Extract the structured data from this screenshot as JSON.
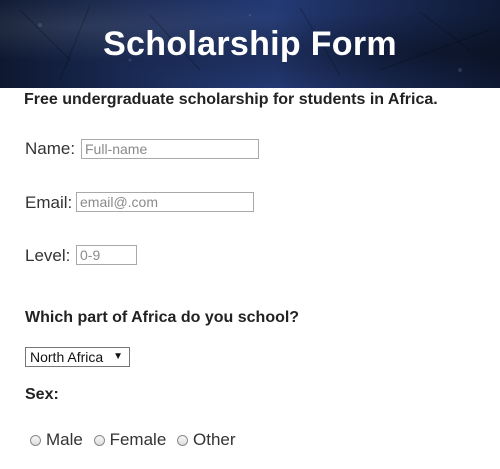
{
  "header": {
    "title": "Scholarship Form"
  },
  "intro": {
    "text": "Free undergraduate scholarship for students in Africa."
  },
  "form": {
    "name": {
      "label": "Name:",
      "placeholder": "Full-name",
      "value": ""
    },
    "email": {
      "label": "Email:",
      "placeholder": "email@.com",
      "value": ""
    },
    "level": {
      "label": "Level:",
      "placeholder": "0-9",
      "value": ""
    },
    "region": {
      "question": "Which part of Africa do you school?",
      "selected": "North Africa"
    },
    "sex": {
      "question": "Sex:",
      "options": [
        "Male",
        "Female",
        "Other"
      ]
    }
  },
  "colors": {
    "header_dark": "#0e1830",
    "header_mid": "#243a75",
    "header_text": "#ffffff"
  }
}
